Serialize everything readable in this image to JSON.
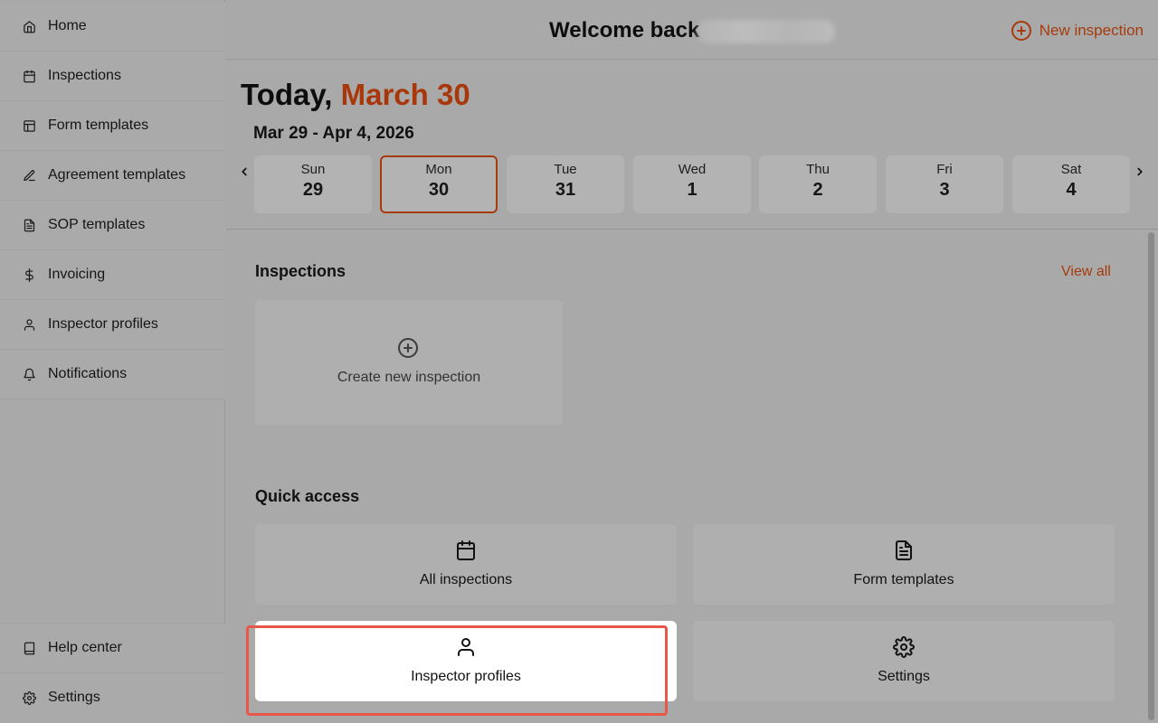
{
  "sidebar": {
    "items": [
      {
        "label": "Home",
        "icon": "home-icon"
      },
      {
        "label": "Inspections",
        "icon": "calendar-icon"
      },
      {
        "label": "Form templates",
        "icon": "layout-template-icon"
      },
      {
        "label": "Agreement templates",
        "icon": "signature-icon"
      },
      {
        "label": "SOP templates",
        "icon": "file-text-icon"
      },
      {
        "label": "Invoicing",
        "icon": "dollar-sign-icon"
      },
      {
        "label": "Inspector profiles",
        "icon": "user-icon"
      },
      {
        "label": "Notifications",
        "icon": "bell-icon"
      }
    ],
    "bottom_items": [
      {
        "label": "Help center",
        "icon": "book-icon"
      },
      {
        "label": "Settings",
        "icon": "gear-icon"
      }
    ]
  },
  "header": {
    "welcome": "Welcome back",
    "new_inspection": "New inspection"
  },
  "date": {
    "today_prefix": "Today, ",
    "today_date": "March 30",
    "range": "Mar 29 - Apr 4, 2026",
    "days": [
      {
        "name": "Sun",
        "num": "29",
        "selected": false
      },
      {
        "name": "Mon",
        "num": "30",
        "selected": true
      },
      {
        "name": "Tue",
        "num": "31",
        "selected": false
      },
      {
        "name": "Wed",
        "num": "1",
        "selected": false
      },
      {
        "name": "Thu",
        "num": "2",
        "selected": false
      },
      {
        "name": "Fri",
        "num": "3",
        "selected": false
      },
      {
        "name": "Sat",
        "num": "4",
        "selected": false
      }
    ]
  },
  "inspections": {
    "title": "Inspections",
    "view_all": "View all",
    "create": "Create new inspection"
  },
  "quick_access": {
    "title": "Quick access",
    "cards": [
      {
        "label": "All inspections",
        "icon": "calendar-icon"
      },
      {
        "label": "Form templates",
        "icon": "file-text-icon"
      },
      {
        "label": "Inspector profiles",
        "icon": "user-icon",
        "highlighted": true
      },
      {
        "label": "Settings",
        "icon": "gear-icon"
      }
    ]
  },
  "colors": {
    "accent": "#a63b0e",
    "highlight": "#e8584a",
    "overlay_bg": "#a9a9a9"
  }
}
